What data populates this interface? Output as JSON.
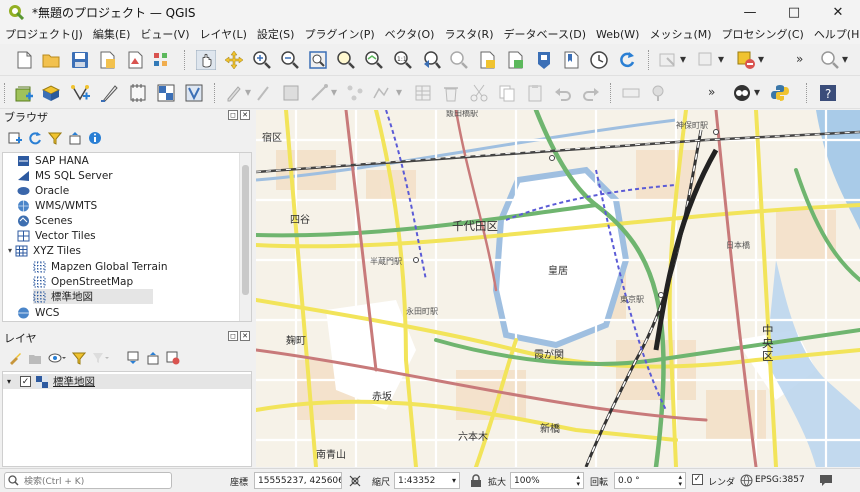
{
  "window": {
    "title": "*無題のプロジェクト — QGIS"
  },
  "menu": [
    "プロジェクト(J)",
    "編集(E)",
    "ビュー(V)",
    "レイヤ(L)",
    "設定(S)",
    "プラグイン(P)",
    "ベクタ(O)",
    "ラスタ(R)",
    "データベース(D)",
    "Web(W)",
    "メッシュ(M)",
    "プロセシング(C)",
    "ヘルプ(H)"
  ],
  "browser": {
    "title": "ブラウザ",
    "items": [
      {
        "label": "SAP HANA",
        "icon": "sap-hana-icon"
      },
      {
        "label": "MS SQL Server",
        "icon": "mssql-icon"
      },
      {
        "label": "Oracle",
        "icon": "oracle-icon"
      },
      {
        "label": "WMS/WMTS",
        "icon": "wms-icon"
      },
      {
        "label": "Scenes",
        "icon": "scenes-icon"
      },
      {
        "label": "Vector Tiles",
        "icon": "vector-tiles-icon"
      },
      {
        "label": "XYZ Tiles",
        "icon": "xyz-tiles-icon"
      },
      {
        "label": "Mapzen Global Terrain",
        "icon": "xyz-tile-icon"
      },
      {
        "label": "OpenStreetMap",
        "icon": "xyz-tile-icon"
      },
      {
        "label": "標準地図",
        "icon": "xyz-tile-icon"
      },
      {
        "label": "WCS",
        "icon": "wcs-icon"
      }
    ]
  },
  "layers": {
    "title": "レイヤ",
    "items": [
      {
        "label": "標準地図",
        "checked": true
      }
    ]
  },
  "map": {
    "labels": [
      "飯田橋駅",
      "神保町駅",
      "宿区",
      "四谷",
      "千代田区",
      "半蔵門駅",
      "皇居",
      "東京駅",
      "中央区",
      "永田町駅",
      "霞が関",
      "赤坂",
      "新橋",
      "六本木",
      "南青山",
      "麹町",
      "日本橋"
    ]
  },
  "status": {
    "search_placeholder": "検索(Ctrl + K)",
    "coord_label": "座標",
    "coord_value": "15555237, 4256067",
    "scale_label": "縮尺",
    "scale_value": "1:43352",
    "zoom_label": "拡大",
    "zoom_value": "100%",
    "rotation_label": "回転",
    "rotation_value": "0.0 °",
    "render_label": "レンダ",
    "crs_label": "EPSG:3857"
  }
}
